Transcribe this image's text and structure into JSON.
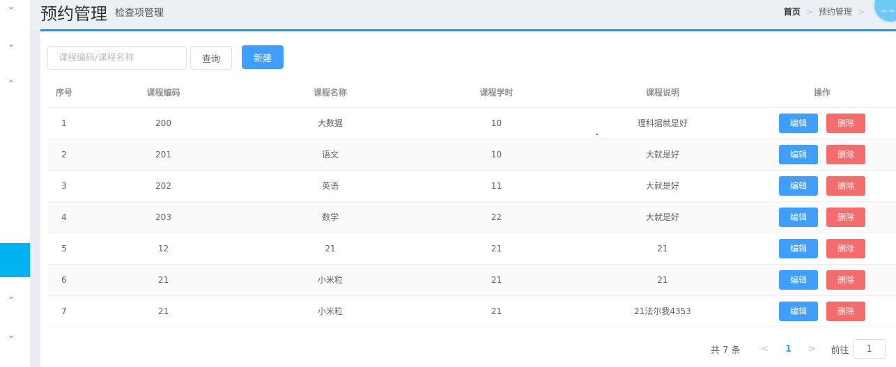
{
  "header": {
    "title": "预约管理",
    "subtitle": "检查项管理",
    "breadcrumb": {
      "home": "首页",
      "current": "预约管理"
    }
  },
  "toolbar": {
    "search_placeholder": "课程编码/课程名称",
    "query_label": "查询",
    "new_label": "新建"
  },
  "table": {
    "columns": [
      "序号",
      "课程编码",
      "课程名称",
      "课程学时",
      "课程说明",
      "操作"
    ],
    "edit_label": "编辑",
    "delete_label": "删除",
    "rows": [
      [
        "1",
        "200",
        "大数据",
        "10",
        "理科据就是好"
      ],
      [
        "2",
        "201",
        "语文",
        "10",
        "大就是好"
      ],
      [
        "3",
        "202",
        "英语",
        "11",
        "大就是好"
      ],
      [
        "4",
        "203",
        "数学",
        "22",
        "大就是好"
      ],
      [
        "5",
        "12",
        "21",
        "21",
        "21"
      ],
      [
        "6",
        "21",
        "小米粒",
        "21",
        "21"
      ],
      [
        "7",
        "21",
        "小米粒",
        "21",
        "21法尔我4353"
      ]
    ]
  },
  "pagination": {
    "total_text": "共 7 条",
    "current_page": "1",
    "goto_label": "前往",
    "goto_value": "1"
  },
  "colors": {
    "primary": "#409eff",
    "danger": "#f56c6c",
    "sidebar_active": "#00b2f0",
    "panel_top_border": "#3c8dbc"
  }
}
